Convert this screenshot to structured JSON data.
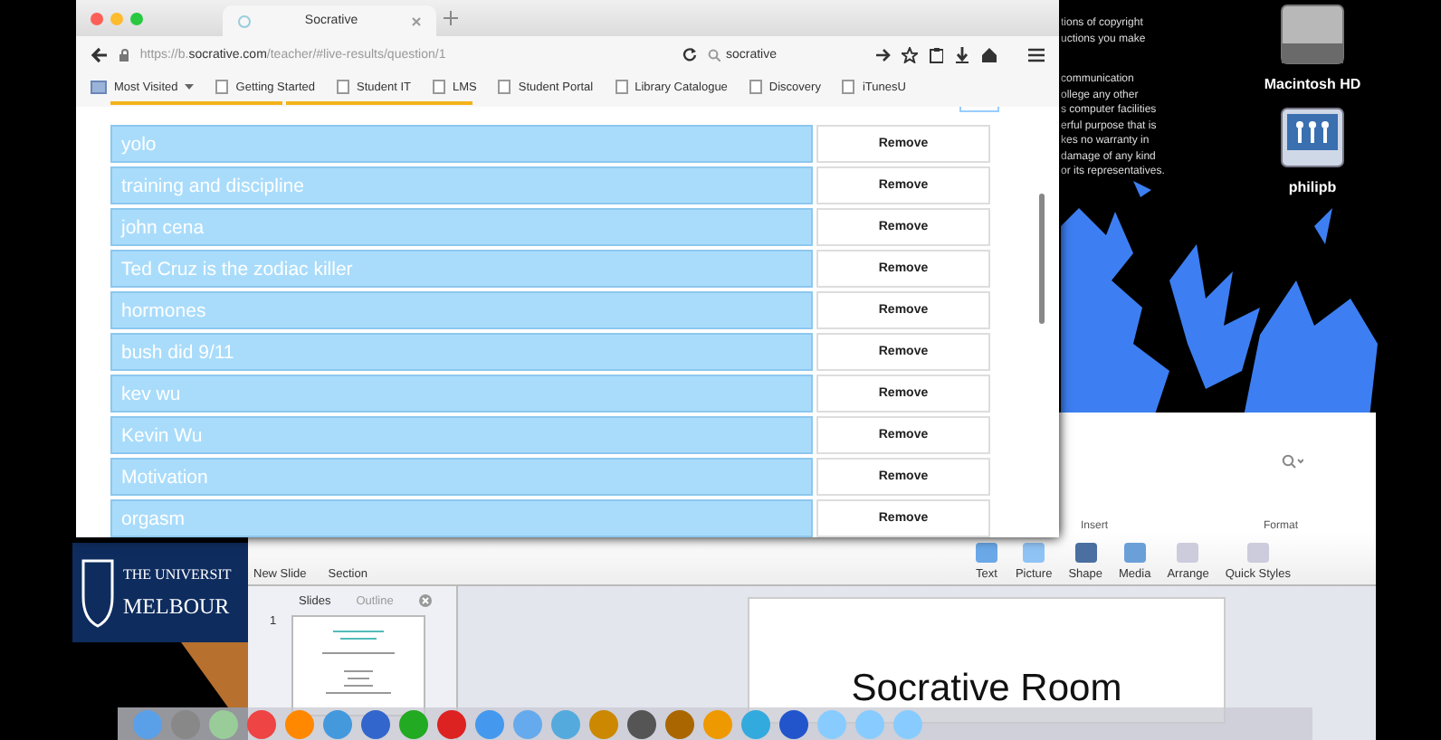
{
  "desktop": {
    "notice": [
      [
        "tions of copyright",
        "uctions you make"
      ],
      [
        "communication",
        "ollege any other",
        "s computer facilities",
        "erful purpose that is",
        "kes no warranty in",
        "damage of any kind",
        "or its representatives."
      ]
    ],
    "icons": [
      {
        "label": "Macintosh HD",
        "kind": "drive"
      },
      {
        "label": "philipb",
        "kind": "network"
      }
    ]
  },
  "browser": {
    "tabs": [
      {
        "title": "Socrative",
        "selected": true
      }
    ],
    "url": "https://b.**socrative.com**/teacher/#live-results/question/1",
    "search": {
      "value": "socrative"
    },
    "bookmarks": [
      {
        "label": "Most Visited",
        "kind": "menu"
      },
      {
        "label": "Getting Started",
        "kind": "page"
      },
      {
        "label": "Student IT",
        "kind": "page"
      },
      {
        "label": "LMS",
        "kind": "page"
      },
      {
        "label": "Student Portal",
        "kind": "page"
      },
      {
        "label": "Library Catalogue",
        "kind": "page"
      },
      {
        "label": "Discovery",
        "kind": "page"
      },
      {
        "label": "iTunesU",
        "kind": "page"
      }
    ],
    "answers": [
      {
        "text": "yolo",
        "selected": true,
        "action": "Remove"
      },
      {
        "text": "training and discipline",
        "selected": true,
        "action": "Remove"
      },
      {
        "text": "john cena",
        "selected": true,
        "action": "Remove"
      },
      {
        "text": "Ted Cruz is the zodiac killer",
        "selected": true,
        "action": "Remove"
      },
      {
        "text": "hormones",
        "selected": true,
        "action": "Remove"
      },
      {
        "text": "bush did 9/11",
        "selected": true,
        "action": "Remove"
      },
      {
        "text": "kev wu",
        "selected": true,
        "action": "Remove"
      },
      {
        "text": "Kevin Wu",
        "selected": true,
        "action": "Remove"
      },
      {
        "text": "Motivation",
        "selected": true,
        "action": "Remove"
      },
      {
        "text": "orgasm",
        "selected": true,
        "action": "Remove"
      }
    ]
  },
  "powerpoint": {
    "groups": [
      "Insert",
      "Format"
    ],
    "left_tools": [
      "New Slide",
      "Section"
    ],
    "tools": [
      "Text",
      "Picture",
      "Shape",
      "Media",
      "Arrange",
      "Quick Styles"
    ],
    "pane_tabs": [
      {
        "label": "Slides",
        "selected": true
      },
      {
        "label": "Outline",
        "selected": false
      }
    ],
    "slide_number": "1",
    "slide_title": "Socrative Room"
  },
  "logo": {
    "lines": [
      "THE UNIVERSIT",
      "MELBOUR"
    ]
  }
}
